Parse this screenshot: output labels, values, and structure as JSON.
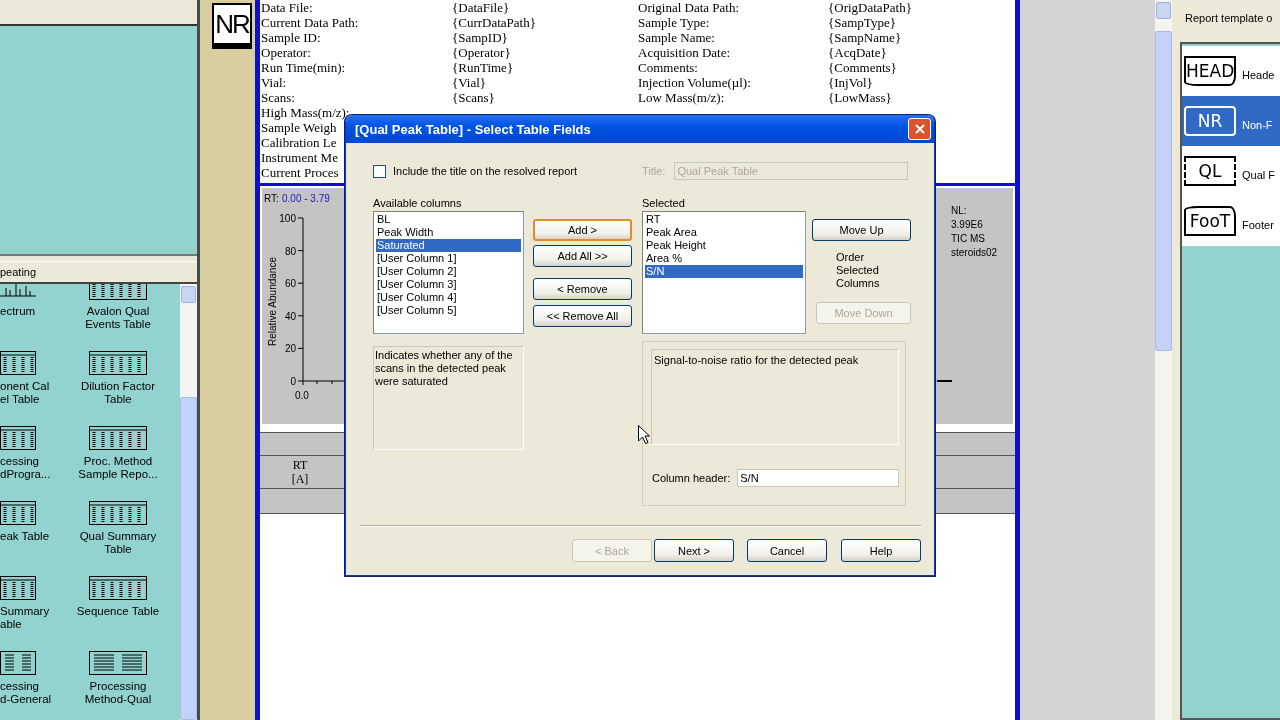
{
  "palette": {
    "section_title": "peating",
    "items": [
      {
        "label": "ectrum",
        "kind": "spectrum"
      },
      {
        "label": "Avalon Qual\nEvents Table",
        "kind": "table"
      },
      {
        "label": "onent Cal\nel Table",
        "kind": "table"
      },
      {
        "label": "Dilution Factor\nTable",
        "kind": "table"
      },
      {
        "label": "cessing\ndProgra...",
        "kind": "table"
      },
      {
        "label": "Proc. Method\nSample Repo...",
        "kind": "table"
      },
      {
        "label": "eak Table",
        "kind": "table"
      },
      {
        "label": "Qual Summary\nTable",
        "kind": "table"
      },
      {
        "label": "Summary\nable",
        "kind": "table"
      },
      {
        "label": "Sequence Table",
        "kind": "table"
      },
      {
        "label": "cessing\nd-General",
        "kind": "method"
      },
      {
        "label": "Processing\nMethod-Qual",
        "kind": "method"
      }
    ]
  },
  "document": {
    "icon_text": "NR",
    "rows": [
      {
        "cells": [
          "Data File:",
          "{DataFile}",
          "Original Data Path:",
          "{OrigDataPath}"
        ]
      },
      {
        "cells": [
          "Current Data Path:",
          "{CurrDataPath}",
          "Sample Type:",
          "{SampType}"
        ]
      },
      {
        "cells": [
          "Sample ID:",
          "{SampID}",
          "Sample Name:",
          "{SampName}"
        ]
      },
      {
        "cells": [
          "Operator:",
          "{Operator}",
          "Acquisition Date:",
          "{AcqDate}"
        ]
      },
      {
        "cells": [
          "Run Time(min):",
          "{RunTime}",
          "Comments:",
          "{Comments}"
        ]
      },
      {
        "cells": [
          "Vial:",
          "{Vial}",
          "Injection Volume(µl):",
          "{InjVol}"
        ]
      },
      {
        "cells": [
          "Scans:",
          "{Scans}",
          "Low Mass(m/z):",
          "{LowMass}"
        ]
      },
      {
        "cells": [
          "High Mass(m/z):"
        ]
      },
      {
        "cells": [
          "Sample Weigh"
        ]
      },
      {
        "cells": [
          "Calibration Le"
        ]
      },
      {
        "cells": [
          "Instrument Me"
        ]
      },
      {
        "cells": [
          "Current Proces"
        ]
      }
    ],
    "chromatogram": {
      "range_label": "RT:",
      "range": "0.00 - 3.79",
      "y_label": "Relative Abundance",
      "y_ticks": [
        "100",
        "80",
        "60",
        "40",
        "20",
        "0"
      ],
      "x_ticks": [
        "0.0"
      ],
      "info": [
        "NL:",
        "3.99E6",
        "TIC  MS",
        "steroids02"
      ]
    },
    "table_header": "RT\n[A]"
  },
  "template_panel": {
    "title": "Report template o",
    "items": [
      {
        "icon_text": "HEAD",
        "label": "Heade",
        "kind": "header",
        "selected": false
      },
      {
        "icon_text": "NR",
        "label": "Non-F",
        "kind": "plain",
        "selected": true
      },
      {
        "icon_text": "QL",
        "label": "Qual F",
        "kind": "loop",
        "selected": false
      },
      {
        "icon_text": "FooT",
        "label": "Footer",
        "kind": "footer",
        "selected": false
      }
    ]
  },
  "dialog": {
    "title": "[Qual Peak Table] - Select Table Fields",
    "include_title": {
      "label": "Include the title on the resolved report",
      "checked": false
    },
    "title_field": {
      "label": "Title:",
      "value": "Qual Peak Table",
      "disabled": true
    },
    "available": {
      "label": "Available columns",
      "items": [
        {
          "text": "BL",
          "selected": false
        },
        {
          "text": "Peak Width",
          "selected": false
        },
        {
          "text": "Saturated",
          "selected": true
        },
        {
          "text": "[User Column 1]",
          "selected": false
        },
        {
          "text": "[User Column 2]",
          "selected": false
        },
        {
          "text": "[User Column 3]",
          "selected": false
        },
        {
          "text": "[User Column 4]",
          "selected": false
        },
        {
          "text": "[User Column 5]",
          "selected": false
        }
      ]
    },
    "transfer_buttons": [
      {
        "label": "Add >",
        "focused": true
      },
      {
        "label": "Add All >>",
        "focused": false
      },
      {
        "label": "< Remove",
        "focused": false
      },
      {
        "label": "<< Remove All",
        "focused": false
      }
    ],
    "selected": {
      "label": "Selected",
      "items": [
        {
          "text": "RT",
          "selected": false
        },
        {
          "text": "Peak Area",
          "selected": false
        },
        {
          "text": "Peak Height",
          "selected": false
        },
        {
          "text": "Area %",
          "selected": false
        },
        {
          "text": "S/N",
          "selected": true
        }
      ]
    },
    "order_buttons": [
      {
        "label": "Move Up",
        "disabled": false
      },
      {
        "label": "Move Down",
        "disabled": true
      }
    ],
    "order_label": "Order Selected Columns",
    "available_description": "Indicates whether any of the scans in the detected peak were saturated",
    "selected_description": "Signal-to-noise ratio for the detected peak",
    "column_header": {
      "label": "Column header:",
      "value": "S/N"
    },
    "footer_buttons": [
      {
        "label": "< Back",
        "disabled": true
      },
      {
        "label": "Next >",
        "disabled": false
      },
      {
        "label": "Cancel",
        "disabled": false
      },
      {
        "label": "Help",
        "disabled": false
      }
    ]
  }
}
